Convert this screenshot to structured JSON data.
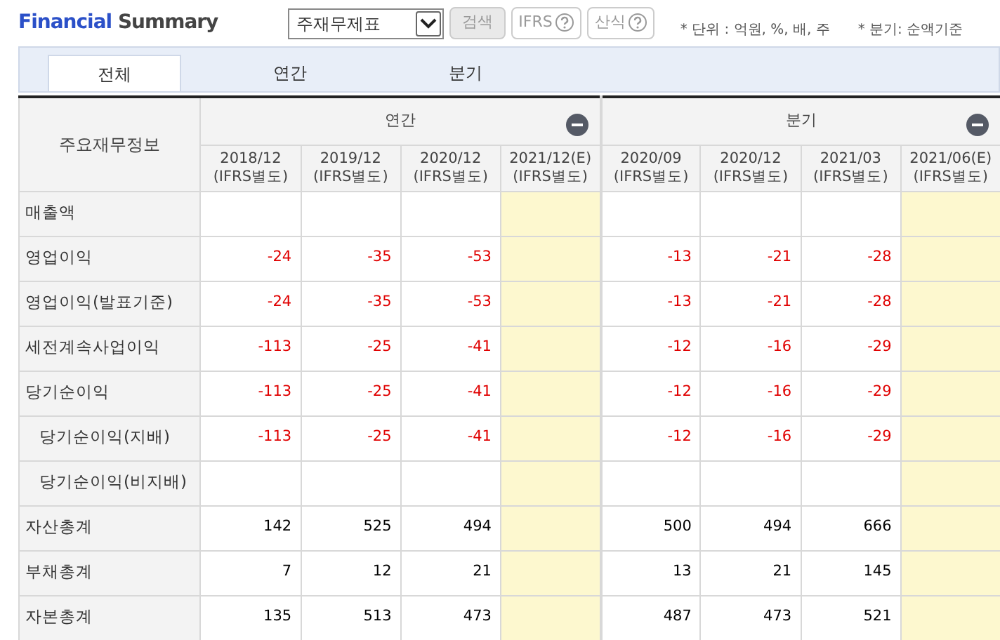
{
  "header": {
    "title_brand": "Financial",
    "title_rest": "Summary",
    "select": {
      "value": "주재무제표"
    },
    "buttons": [
      {
        "label": "검색",
        "help": false
      },
      {
        "label": "IFRS",
        "help": true
      },
      {
        "label": "산식",
        "help": true
      }
    ],
    "notes": [
      "* 단위 : 억원, %, 배, 주",
      "* 분기: 순액기준"
    ]
  },
  "tabs": [
    {
      "label": "전체",
      "selected": true
    },
    {
      "label": "연간",
      "selected": false
    },
    {
      "label": "분기",
      "selected": false
    }
  ],
  "table": {
    "corner": "주요재무정보",
    "groups": [
      {
        "label": "연간",
        "expanded": true,
        "columns": [
          {
            "period": "2018/12",
            "basis": "(IFRS별도)",
            "estimate": false
          },
          {
            "period": "2019/12",
            "basis": "(IFRS별도)",
            "estimate": false
          },
          {
            "period": "2020/12",
            "basis": "(IFRS별도)",
            "estimate": false
          },
          {
            "period": "2021/12(E)",
            "basis": "(IFRS별도)",
            "estimate": true
          }
        ]
      },
      {
        "label": "분기",
        "expanded": true,
        "columns": [
          {
            "period": "2020/09",
            "basis": "(IFRS별도)",
            "estimate": false
          },
          {
            "period": "2020/12",
            "basis": "(IFRS별도)",
            "estimate": false
          },
          {
            "period": "2021/03",
            "basis": "(IFRS별도)",
            "estimate": false
          },
          {
            "period": "2021/06(E)",
            "basis": "(IFRS별도)",
            "estimate": true
          }
        ]
      }
    ],
    "rows": [
      {
        "label": "매출액",
        "cells": [
          null,
          null,
          null,
          null,
          null,
          null,
          null,
          null
        ]
      },
      {
        "label": "영업이익",
        "negative": true,
        "cells": [
          "-24",
          "-35",
          "-53",
          null,
          "-13",
          "-21",
          "-28",
          null
        ]
      },
      {
        "label": "영업이익(발표기준)",
        "negative": true,
        "cells": [
          "-24",
          "-35",
          "-53",
          null,
          "-13",
          "-21",
          "-28",
          null
        ]
      },
      {
        "label": "세전계속사업이익",
        "negative": true,
        "cells": [
          "-113",
          "-25",
          "-41",
          null,
          "-12",
          "-16",
          "-29",
          null
        ]
      },
      {
        "label": "당기순이익",
        "negative": true,
        "cells": [
          "-113",
          "-25",
          "-41",
          null,
          "-12",
          "-16",
          "-29",
          null
        ],
        "children": [
          {
            "label": "당기순이익(지배)",
            "negative": true,
            "cells": [
              "-113",
              "-25",
              "-41",
              null,
              "-12",
              "-16",
              "-29",
              null
            ]
          },
          {
            "label": "당기순이익(비지배)",
            "cells": [
              null,
              null,
              null,
              null,
              null,
              null,
              null,
              null
            ]
          }
        ]
      },
      {
        "label": "자산총계",
        "negative": false,
        "cells": [
          "142",
          "525",
          "494",
          null,
          "500",
          "494",
          "666",
          null
        ]
      },
      {
        "label": "부채총계",
        "negative": false,
        "cells": [
          "7",
          "12",
          "21",
          null,
          "13",
          "21",
          "145",
          null
        ]
      },
      {
        "label": "자본총계",
        "negative": false,
        "cells": [
          "135",
          "513",
          "473",
          null,
          "487",
          "473",
          "521",
          null
        ]
      }
    ]
  }
}
